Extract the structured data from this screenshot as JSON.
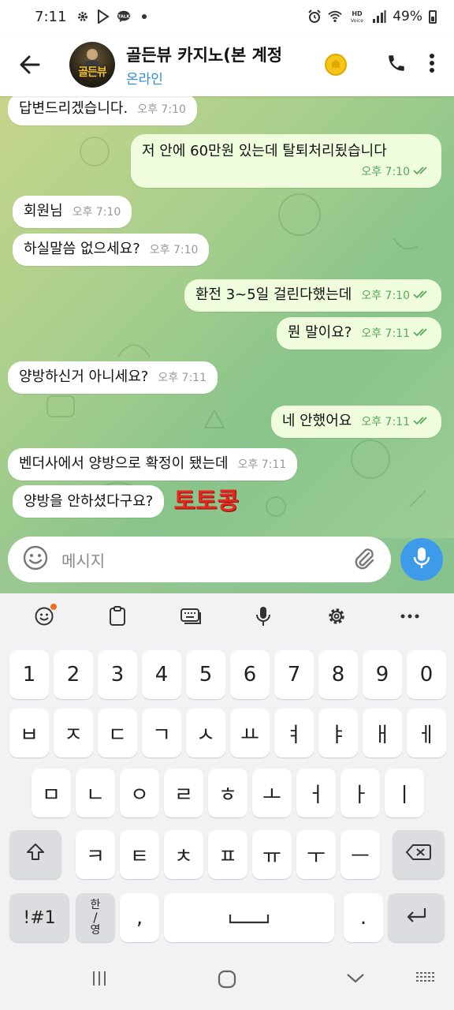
{
  "status_bar": {
    "time": "7:11",
    "battery": "49%",
    "icons_left": [
      "gear-icon",
      "play-store-icon",
      "talk-icon",
      "dot-icon"
    ],
    "talk_label": "TALK",
    "icons_right": [
      "alarm-icon",
      "wifi-icon",
      "hd-voice-icon",
      "signal-icon",
      "battery-icon"
    ],
    "hd_label": "HD",
    "voice_label": "Voice"
  },
  "header": {
    "title": "골든뷰 카지노(본 계정",
    "status": "온라인",
    "avatar_text": "골든뷰",
    "icons": [
      "back-arrow-icon",
      "phone-icon",
      "more-vert-icon"
    ]
  },
  "messages": [
    {
      "dir": "in",
      "text": "답변드리겠습니다.",
      "time": "오후 7:10"
    },
    {
      "dir": "out",
      "text": "저 안에 60만원 있는데 탈퇴처리됬습니다",
      "time": "오후 7:10"
    },
    {
      "dir": "in",
      "text": "회원님",
      "time": "오후 7:10"
    },
    {
      "dir": "in",
      "text": "하실말씀 없으세요?",
      "time": "오후 7:10"
    },
    {
      "dir": "out",
      "text": "환전 3~5일 걸린다했는데",
      "time": "오후 7:10"
    },
    {
      "dir": "out",
      "text": "뭔 말이요?",
      "time": "오후 7:11"
    },
    {
      "dir": "in",
      "text": "양방하신거 아니세요?",
      "time": "오후 7:11"
    },
    {
      "dir": "out",
      "text": "네 안했어요",
      "time": "오후 7:11"
    },
    {
      "dir": "in",
      "text": "벤더사에서 양방으로 확정이 됐는데",
      "time": "오후 7:11"
    },
    {
      "dir": "in",
      "text": "양방을 안하셨다구요?",
      "time": ""
    }
  ],
  "watermark": "토토콩",
  "composer": {
    "placeholder": "메시지",
    "icons": [
      "emoji-icon",
      "attach-icon",
      "mic-icon"
    ]
  },
  "keyboard": {
    "toolbar": [
      "emoji-icon",
      "clipboard-icon",
      "keyboard-icon",
      "mic-icon",
      "settings-icon",
      "more-icon"
    ],
    "row_numbers": [
      "1",
      "2",
      "3",
      "4",
      "5",
      "6",
      "7",
      "8",
      "9",
      "0"
    ],
    "row1": [
      "ㅂ",
      "ㅈ",
      "ㄷ",
      "ㄱ",
      "ㅅ",
      "ㅛ",
      "ㅕ",
      "ㅑ",
      "ㅐ",
      "ㅔ"
    ],
    "row2": [
      "ㅁ",
      "ㄴ",
      "ㅇ",
      "ㄹ",
      "ㅎ",
      "ㅗ",
      "ㅓ",
      "ㅏ",
      "ㅣ"
    ],
    "row3": [
      "ㅋ",
      "ㅌ",
      "ㅊ",
      "ㅍ",
      "ㅠ",
      "ㅜ",
      "ㅡ"
    ],
    "symbols_key": "!#1",
    "lang_key_top": "한",
    "lang_key_bottom": "영",
    "comma_key": ",",
    "period_key": "."
  },
  "navbar": {
    "icons": [
      "recents-icon",
      "home-icon",
      "back-icon",
      "keyboard-grid-icon"
    ]
  },
  "colors": {
    "accent_blue": "#3d9be9",
    "status_blue": "#2f8fd8",
    "bubble_out": "#effddd",
    "watermark_red": "#e8261f",
    "read_check_green": "#5aa85e"
  }
}
